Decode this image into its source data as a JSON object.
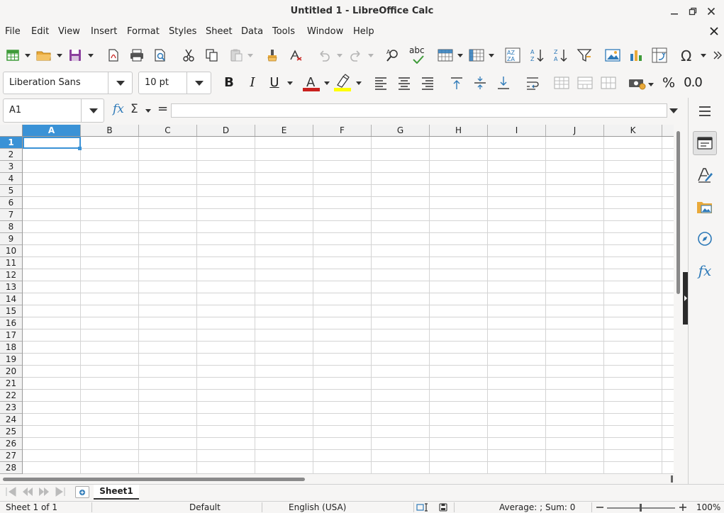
{
  "window": {
    "title": "Untitled 1 - LibreOffice Calc"
  },
  "menu": [
    "File",
    "Edit",
    "View",
    "Insert",
    "Format",
    "Styles",
    "Sheet",
    "Data",
    "Tools",
    "Window",
    "Help"
  ],
  "toolbar": {
    "font_name": "Liberation Sans",
    "font_size": "10 pt",
    "bold_label": "B",
    "italic_label": "I",
    "underline_label": "U",
    "percent_label": "%",
    "decimal_label": "0.0",
    "spellcheck_label": "abc"
  },
  "formula_bar": {
    "cell_ref": "A1",
    "fx_label": "fx",
    "sum_label": "Σ",
    "equals_label": "=",
    "formula": ""
  },
  "grid": {
    "columns": [
      "A",
      "B",
      "C",
      "D",
      "E",
      "F",
      "G",
      "H",
      "I",
      "J",
      "K"
    ],
    "rows": [
      "1",
      "2",
      "3",
      "4",
      "5",
      "6",
      "7",
      "8",
      "9",
      "10",
      "11",
      "12",
      "13",
      "14",
      "15",
      "16",
      "17",
      "18",
      "19",
      "20",
      "21",
      "22",
      "23",
      "24",
      "25",
      "26",
      "27",
      "28"
    ],
    "selected_column": "A",
    "selected_row": "1"
  },
  "sheets": {
    "tabs": [
      "Sheet1"
    ],
    "active": "Sheet1"
  },
  "status": {
    "sheet_position": "Sheet 1 of 1",
    "page_style": "Default",
    "language": "English (USA)",
    "selection_summary": "Average: ; Sum: 0",
    "zoom": "100%"
  },
  "colors": {
    "accent": "#3a92d6",
    "font_color": "#c9211e",
    "highlight": "#ffff00",
    "icon_green": "#3f9b3a",
    "icon_blue": "#2e7ab8"
  }
}
